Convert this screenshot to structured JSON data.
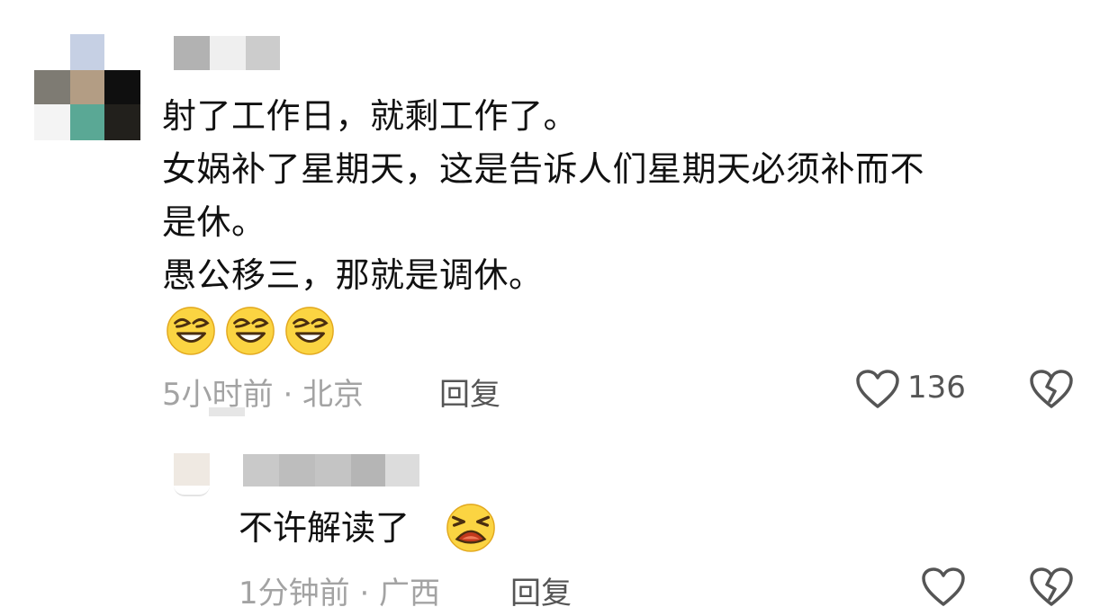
{
  "comment": {
    "lines": [
      "射了工作日，就剩工作了。",
      "女娲补了星期天，这是告诉人们星期天必须补而不",
      "是休。",
      "愚公移三，那就是调休。"
    ],
    "emojis": [
      "grin-squint-icon",
      "grin-squint-icon",
      "grin-squint-icon"
    ],
    "time_location": "5小时前 · 北京",
    "reply_label": "回复",
    "like_count": "136"
  },
  "reply": {
    "text": "不许解读了",
    "emoji": "crying-face-icon",
    "time_location": "1分钟前 · 广西",
    "reply_label": "回复"
  }
}
